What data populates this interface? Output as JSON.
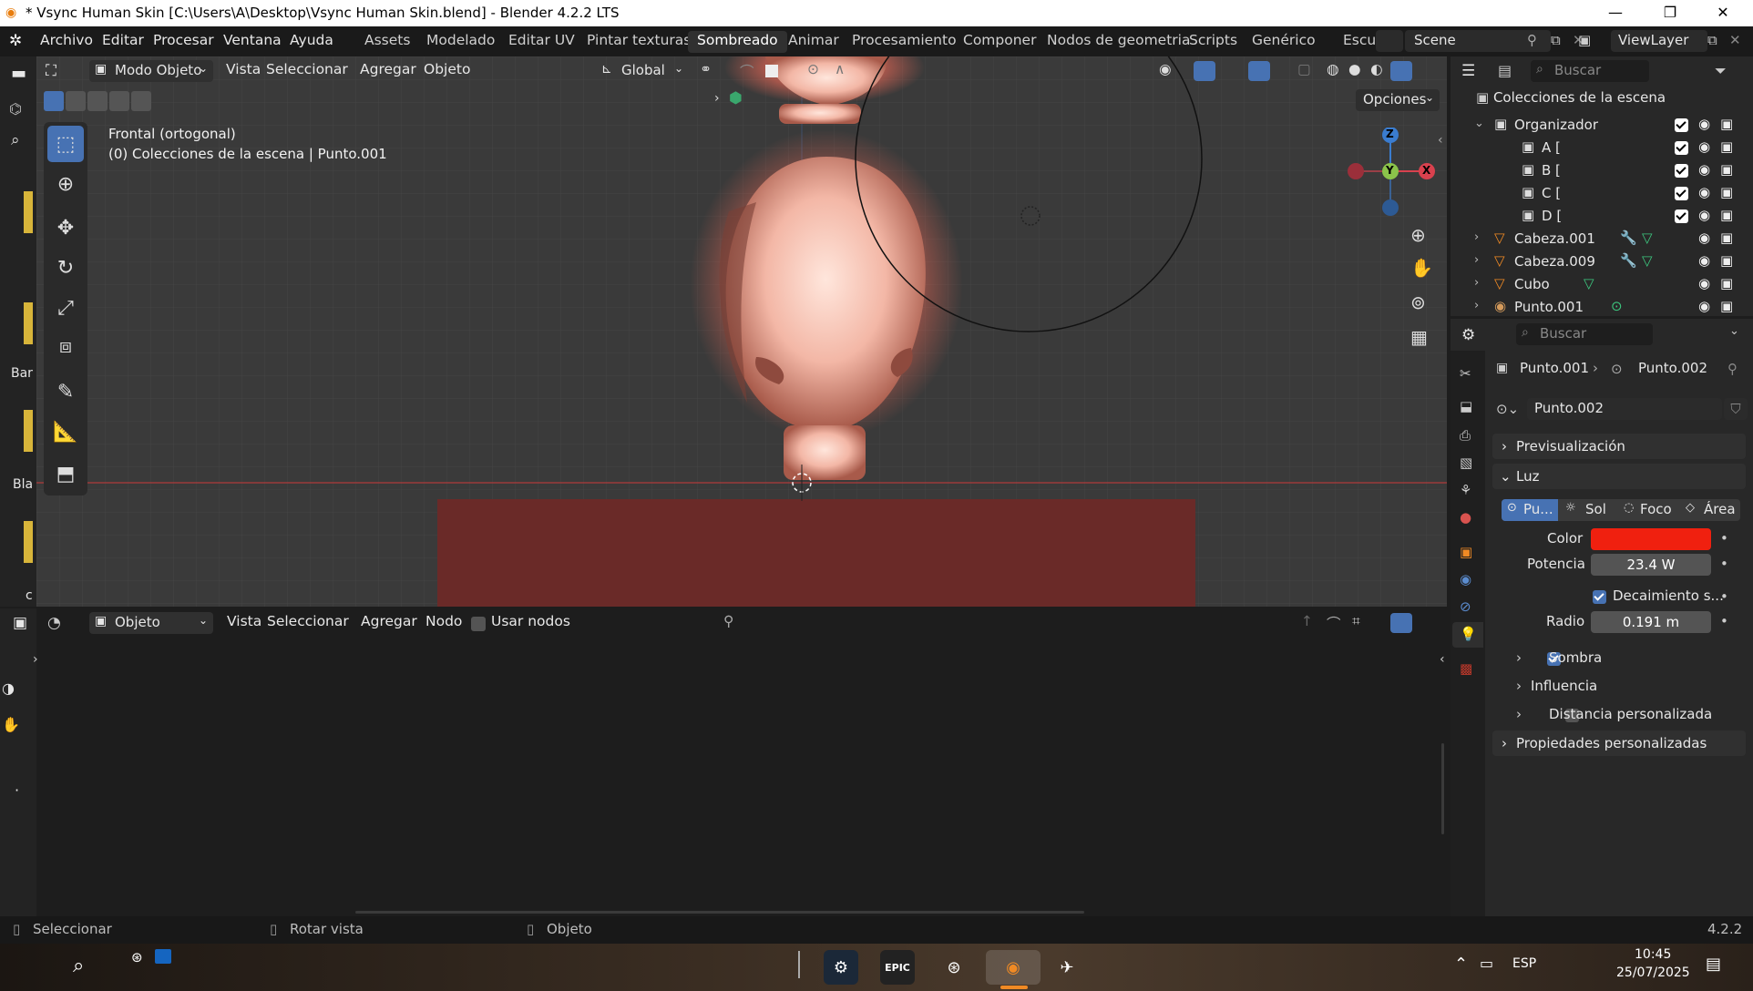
{
  "window": {
    "title": "* Vsync Human Skin [C:\\Users\\A\\Desktop\\Vsync Human Skin.blend] - Blender 4.2.2 LTS",
    "minimize": "—",
    "maximize": "❐",
    "close": "✕"
  },
  "menu": [
    "Archivo",
    "Editar",
    "Procesar",
    "Ventana",
    "Ayuda"
  ],
  "workspaces": [
    "Assets",
    "Modelado",
    "Editar UV",
    "Pintar texturas",
    "Sombreado",
    "Animar",
    "Procesamiento",
    "Componer",
    "Nodos de geometria",
    "Scripts",
    "Genérico",
    "Escul"
  ],
  "active_workspace": "Sombreado",
  "scene": {
    "label": "Scene",
    "viewlayer": "ViewLayer"
  },
  "viewport": {
    "mode": "Modo Objeto",
    "menus": [
      "Vista",
      "Seleccionar",
      "Agregar",
      "Objeto"
    ],
    "orientation": "Global",
    "options": "Opciones",
    "overlay_line1": "Frontal (ortogonal)",
    "overlay_line2": "(0) Colecciones de la escena | Punto.001",
    "side_labels": [
      "Bar",
      "Bla",
      "c"
    ],
    "gizmo": {
      "z": "Z",
      "y": "Y",
      "x": "X"
    }
  },
  "node_editor": {
    "mode": "Objeto",
    "menus": [
      "Vista",
      "Seleccionar",
      "Agregar",
      "Nodo"
    ],
    "use_nodes": "Usar nodos"
  },
  "outliner": {
    "search_placeholder": "Buscar",
    "root": "Colecciones de la escena",
    "items": [
      {
        "name": "Organizador",
        "indent": 1,
        "icon": "collection"
      },
      {
        "name": "A [",
        "indent": 2,
        "icon": "collection"
      },
      {
        "name": "B [",
        "indent": 2,
        "icon": "collection"
      },
      {
        "name": "C [",
        "indent": 2,
        "icon": "collection"
      },
      {
        "name": "D [",
        "indent": 2,
        "icon": "collection"
      },
      {
        "name": "Cabeza.001",
        "indent": 1,
        "icon": "mesh"
      },
      {
        "name": "Cabeza.009",
        "indent": 1,
        "icon": "mesh"
      },
      {
        "name": "Cubo",
        "indent": 1,
        "icon": "mesh"
      },
      {
        "name": "Punto.001",
        "indent": 1,
        "icon": "light"
      }
    ]
  },
  "properties": {
    "search_placeholder": "Buscar",
    "breadcrumb_object": "Punto.001",
    "breadcrumb_data": "Punto.002",
    "datablock": "Punto.002",
    "panels": {
      "preview": "Previsualización",
      "light": "Luz",
      "custom": "Propiedades personalizadas"
    },
    "light_types": [
      "Pu...",
      "Sol",
      "Foco",
      "Área"
    ],
    "color_label": "Color",
    "color_value": "#f0200f",
    "power_label": "Potencia",
    "power_value": "23.4 W",
    "decay_label": "Decaimiento s...",
    "radius_label": "Radio",
    "radius_value": "0.191 m",
    "shadow": "Sombra",
    "influence": "Influencia",
    "custom_distance": "Distancia personalizada"
  },
  "statusbar": {
    "select": "Seleccionar",
    "rotate": "Rotar vista",
    "object": "Objeto",
    "version": "4.2.2"
  },
  "taskbar": {
    "lang": "ESP",
    "time": "10:45",
    "date": "25/07/2025",
    "epic": "EPIC"
  }
}
